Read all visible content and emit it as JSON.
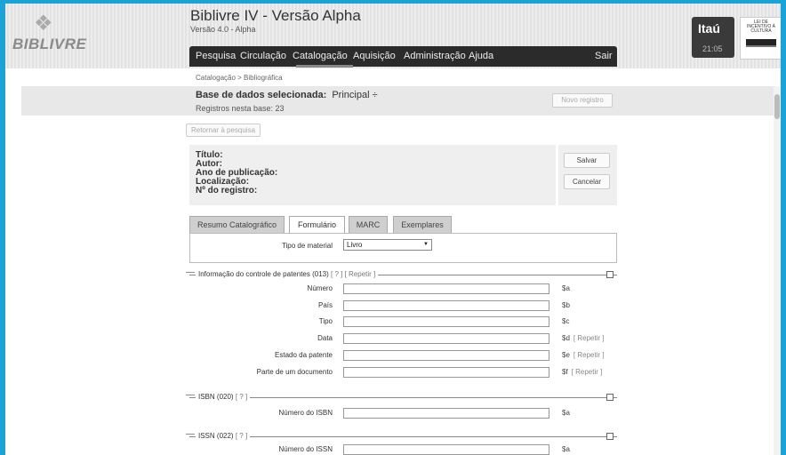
{
  "app": {
    "title": "Biblivre IV - Versão Alpha",
    "version": "Versão 4.0 - Alpha",
    "logo_text": "BIBLIVRE"
  },
  "menu": {
    "items": [
      "Pesquisa",
      "Circulação",
      "Catalogação",
      "Aquisição",
      "Administração",
      "Ajuda"
    ],
    "logout": "Sair",
    "active": "Catalogação"
  },
  "sponsor": {
    "name": "Itaú",
    "time": "21:05",
    "law_text": "LEI DE INCENTIVO À CULTURA"
  },
  "breadcrumb": "Catalogação > Bibliográfica",
  "database": {
    "label": "Base de dados selecionada:",
    "name": "Principal ÷",
    "count": "Registros nesta base: 23",
    "new_record": "Novo registro"
  },
  "back_button": "Retornar à pesquisa",
  "record": {
    "title": "Título:",
    "author": "Autor:",
    "year": "Ano de publicação:",
    "location": "Localização:",
    "number": "Nº do registro:"
  },
  "actions": {
    "save": "Salvar",
    "cancel": "Cancelar"
  },
  "tabs": [
    "Resumo Catalográfico",
    "Formulário",
    "MARC",
    "Exemplares"
  ],
  "material": {
    "label": "Tipo de material",
    "value": "Livro"
  },
  "sections": {
    "patent": {
      "title": "Informação do controle de patentes",
      "code": "(013)",
      "help": "[ ? ]",
      "repeat": "[ Repetir ]",
      "fields": [
        {
          "label": "Número",
          "sub": "$a",
          "repeat": ""
        },
        {
          "label": "País",
          "sub": "$b",
          "repeat": ""
        },
        {
          "label": "Tipo",
          "sub": "$c",
          "repeat": ""
        },
        {
          "label": "Data",
          "sub": "$d",
          "repeat": "[ Repetir ]"
        },
        {
          "label": "Estado da patente",
          "sub": "$e",
          "repeat": "[ Repetir ]"
        },
        {
          "label": "Parte de um documento",
          "sub": "$f",
          "repeat": "[ Repetir ]"
        }
      ]
    },
    "isbn": {
      "title": "ISBN",
      "code": "(020)",
      "help": "[ ? ]",
      "field_label": "Número do ISBN",
      "sub": "$a"
    },
    "issn": {
      "title": "ISSN",
      "code": "(022)",
      "help": "[ ? ]",
      "field_label": "Número do ISSN",
      "sub": "$a"
    }
  }
}
